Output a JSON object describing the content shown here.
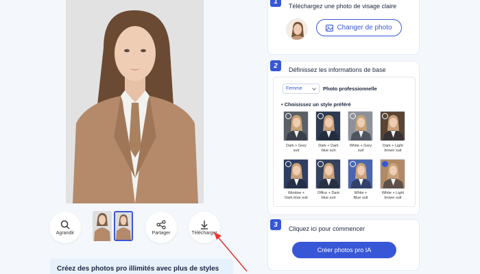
{
  "preview": {
    "actions": {
      "zoom_label": "Agrandir",
      "share_label": "Partager",
      "download_label": "Télécharger"
    }
  },
  "banner": {
    "text": "Créez des photos pro illimités avec plus de styles"
  },
  "step1": {
    "number": "1",
    "title": "Téléchargez une photo de visage claire",
    "change_label": "Changer de photo"
  },
  "step2": {
    "number": "2",
    "title": "Définissez les informations de base",
    "gender_value": "Femme",
    "photo_type": "Photo professionnelle",
    "styles_heading": "• Choisissez un style préféré",
    "styles": [
      {
        "line1": "Dark + Grey",
        "line2": "suit",
        "color": "#5b5f66",
        "selected": false
      },
      {
        "line1": "Dark + Dark",
        "line2": "blue suit",
        "color": "#2e3a52",
        "selected": false
      },
      {
        "line1": "White + Grey",
        "line2": "suit",
        "color": "#8d929a",
        "selected": false
      },
      {
        "line1": "Dark + Light",
        "line2": "brown suit",
        "color": "#5a4535",
        "selected": false
      },
      {
        "line1": "Window +",
        "line2": "Dark blue suit",
        "color": "#2f3f62",
        "selected": false
      },
      {
        "line1": "Office + Dark",
        "line2": "blue suit",
        "color": "#34425e",
        "selected": false
      },
      {
        "line1": "White +",
        "line2": "Blue suit",
        "color": "#4a66b0",
        "selected": false
      },
      {
        "line1": "White + Light",
        "line2": "brown suit",
        "color": "#b08a66",
        "selected": true
      }
    ]
  },
  "step3": {
    "number": "3",
    "title": "Cliquez ici pour commencer",
    "button_label": "Créer photos pro IA"
  },
  "colors": {
    "accent": "#3757d6",
    "banner_bg": "#e6f1fc",
    "arrow": "#e53935"
  }
}
